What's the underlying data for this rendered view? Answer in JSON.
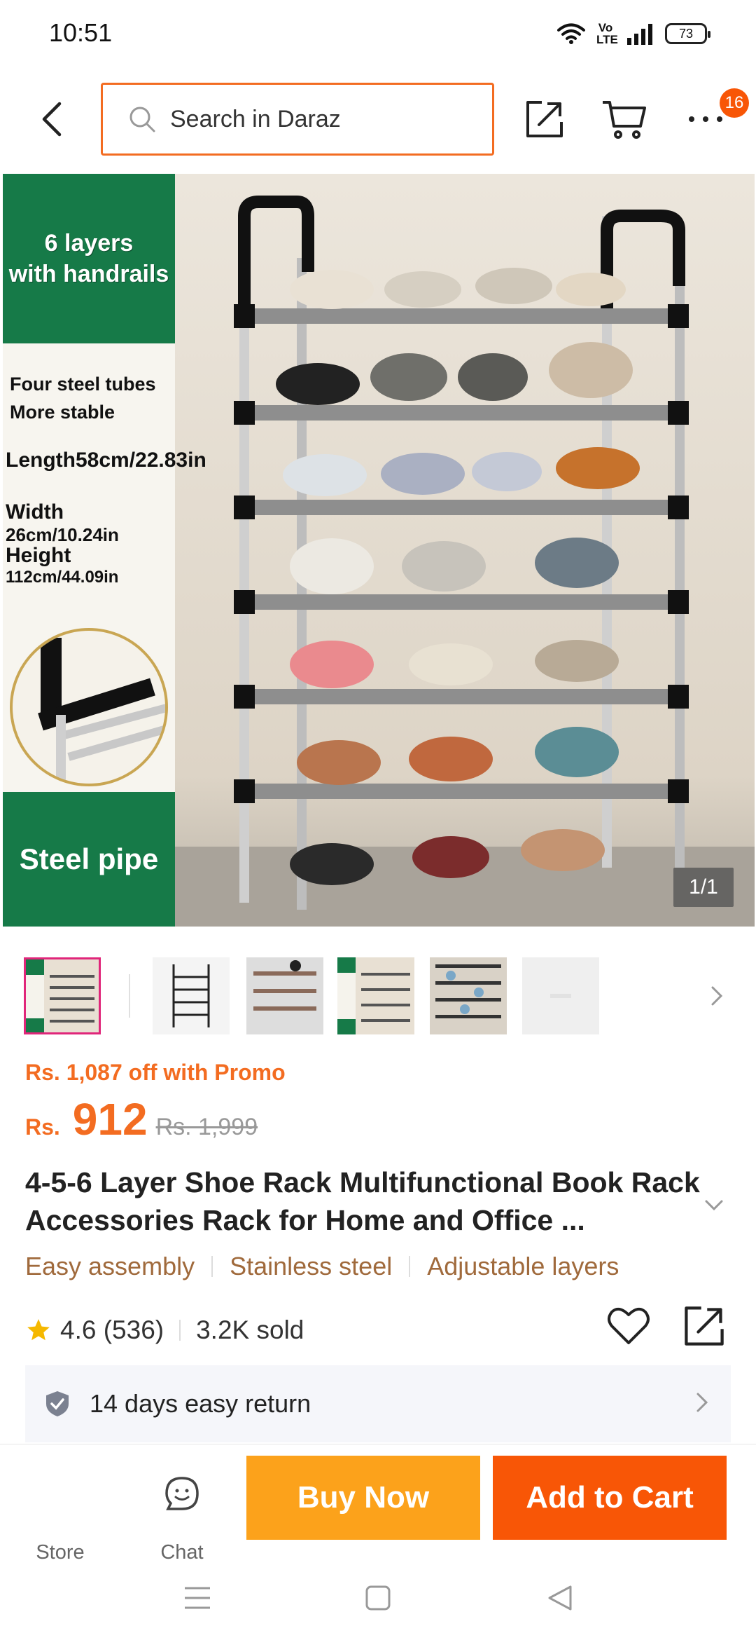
{
  "status_bar": {
    "time": "10:51",
    "volte": "Vo\nLTE",
    "battery": "73"
  },
  "nav": {
    "search_placeholder": "Search in Daraz",
    "cart_badge": "16"
  },
  "product_image": {
    "panel_top": "6 layers\nwith handrails",
    "panel_four_tubes": "Four steel tubes\nMore stable",
    "length_label": "Length",
    "length_value": "58cm/22.83in",
    "width_label": "Width",
    "width_value": "26cm/10.24in",
    "height_label": "Height",
    "height_value": "112cm/44.09in",
    "panel_bottom": "Steel pipe",
    "page_indicator": "1/1"
  },
  "thumbnails": [
    "shoe-rack-main",
    "shoe-rack-empty",
    "shoe-rack-loaded",
    "shoe-rack-infographic",
    "shoe-rack-wide",
    "daraz-placeholder"
  ],
  "price": {
    "promo": "Rs. 1,087 off with Promo",
    "currency": "Rs.",
    "current": "912",
    "original": "Rs. 1,999"
  },
  "title": "4-5-6 Layer Shoe Rack Multifunctional Book Rack Accessories Rack for Home and Office ...",
  "tags": [
    "Easy assembly",
    "Stainless steel",
    "Adjustable layers"
  ],
  "rating": {
    "score": "4.6 (536)",
    "sold": "3.2K sold"
  },
  "return_policy": "14 days easy return",
  "actions": {
    "store": "Store",
    "chat": "Chat",
    "buy_now": "Buy Now",
    "add_to_cart": "Add to Cart"
  },
  "colors": {
    "accent": "#f85606",
    "buy_now": "#fca21b",
    "promo": "#f36c21",
    "tag": "#a06a3c",
    "star": "#f5b800"
  }
}
